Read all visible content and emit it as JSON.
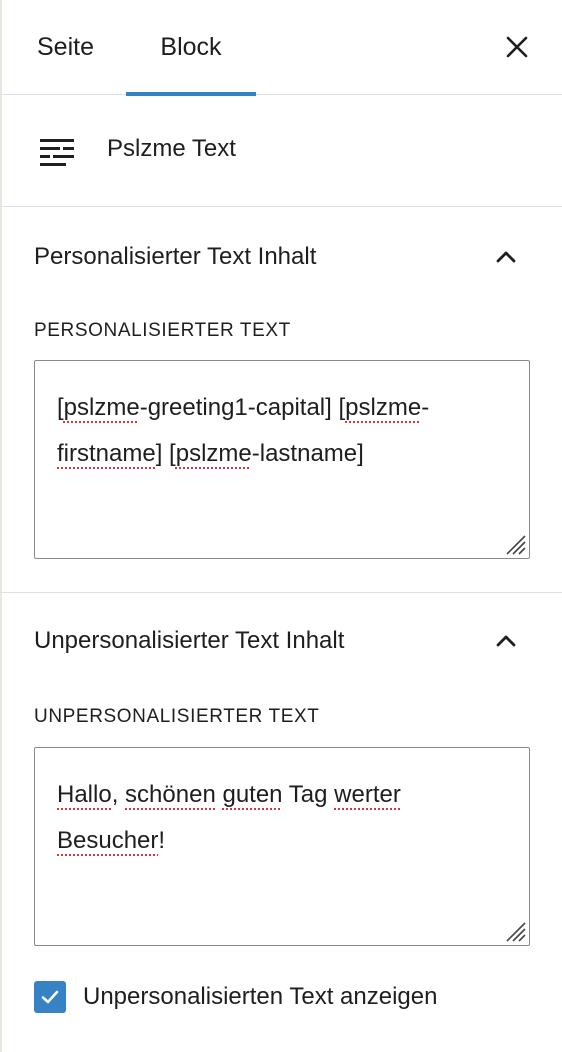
{
  "tabs": {
    "seite_label": "Seite",
    "block_label": "Block",
    "active": "Block"
  },
  "block_card": {
    "icon": "paragraph-lines-icon",
    "title": "Pslzme Text"
  },
  "panel_personalized": {
    "title": "Personalisierter Text Inhalt",
    "expanded": true,
    "field_label": "PERSONALISIERTER TEXT",
    "value_parts": [
      "[",
      "pslzme",
      "-greeting1-capital] [",
      "pslzme",
      "-",
      "firstname",
      "] [",
      "pslzme",
      "-lastname]"
    ],
    "value": "[pslzme-greeting1-capital] [pslzme-firstname] [pslzme-lastname]"
  },
  "panel_unpersonalized": {
    "title": "Unpersonalisierter Text Inhalt",
    "expanded": true,
    "field_label": "UNPERSONALISIERTER TEXT",
    "value_parts": [
      "Hallo",
      ", ",
      "schönen",
      " ",
      "guten",
      " Tag ",
      "werter",
      " ",
      "Besucher",
      "!"
    ],
    "value": "Hallo, schönen guten Tag werter Besucher!"
  },
  "show_unpersonalized": {
    "label": "Unpersonalisierten Text anzeigen",
    "checked": true
  },
  "colors": {
    "accent": "#3582c4",
    "spellcheck": "#d63638",
    "border": "#e0e0e0",
    "text": "#1e1e1e"
  }
}
